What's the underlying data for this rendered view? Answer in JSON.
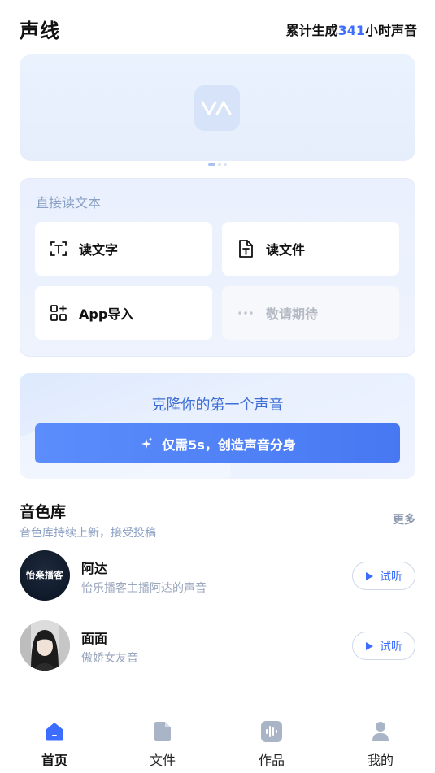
{
  "header": {
    "title": "声线",
    "stats_prefix": "累计生成",
    "stats_value": "341",
    "stats_suffix": "小时声音",
    "accent_color": "#3d6dff"
  },
  "banner": {
    "logo_icon": "va-logo-icon",
    "carousel_pages": 3,
    "carousel_active": 0
  },
  "read_panel": {
    "title": "直接读文本",
    "tiles": [
      {
        "label": "读文字",
        "icon": "text-scan-icon",
        "enabled": true
      },
      {
        "label": "读文件",
        "icon": "file-text-icon",
        "enabled": true
      },
      {
        "label": "App导入",
        "icon": "app-grid-add-icon",
        "enabled": true
      },
      {
        "label": "敬请期待",
        "icon": "more-dots-icon",
        "enabled": false
      }
    ]
  },
  "clone": {
    "title": "克隆你的第一个声音",
    "button_label": "仅需5s，创造声音分身",
    "button_icon": "sparkle-icon"
  },
  "library": {
    "title": "音色库",
    "subtitle": "音色库持续上新，接受投稿",
    "more_label": "更多",
    "voices": [
      {
        "name": "阿达",
        "desc": "怡乐播客主播阿达的声音",
        "avatar_text": "怡楽播客",
        "try_label": "试听"
      },
      {
        "name": "面面",
        "desc": "傲娇女友音",
        "try_label": "试听"
      }
    ]
  },
  "tabbar": {
    "tabs": [
      {
        "label": "首页",
        "icon": "home-icon",
        "active": true
      },
      {
        "label": "文件",
        "icon": "document-icon",
        "active": false
      },
      {
        "label": "作品",
        "icon": "audio-wave-icon",
        "active": false
      },
      {
        "label": "我的",
        "icon": "person-icon",
        "active": false
      }
    ]
  }
}
